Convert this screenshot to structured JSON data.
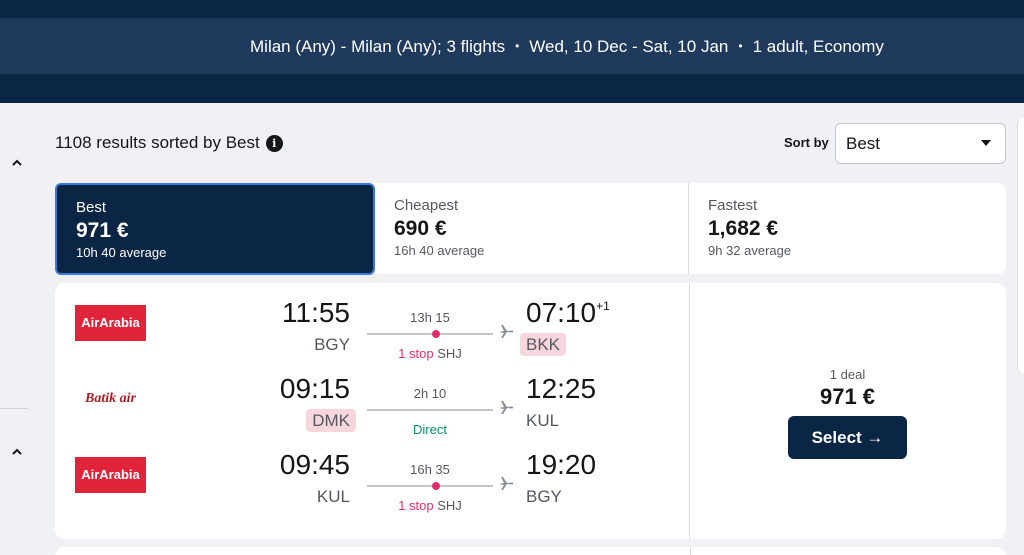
{
  "search": {
    "route": "Milan (Any) - Milan (Any); 3 flights",
    "dates": "Wed, 10 Dec - Sat, 10 Jan",
    "passengers": "1 adult, Economy",
    "separator": "•"
  },
  "results": {
    "count_text": "1108 results sorted by Best",
    "info_icon": "i",
    "sort_label": "Sort by",
    "sort_value": "Best"
  },
  "tabs": [
    {
      "label": "Best",
      "price": "971 €",
      "sub": "10h 40 average"
    },
    {
      "label": "Cheapest",
      "price": "690 €",
      "sub": "16h 40 average"
    },
    {
      "label": "Fastest",
      "price": "1,682 €",
      "sub": "9h 32 average"
    }
  ],
  "itinerary": {
    "legs": [
      {
        "airline_logo": "AirArabia",
        "dep_time": "11:55",
        "dep_code": "BGY",
        "duration": "13h 15",
        "stops": "1 stop",
        "via": "SHJ",
        "arr_time": "07:10",
        "arr_dayoffset": "+1",
        "arr_code": "BKK"
      },
      {
        "airline_logo": "Batik air",
        "dep_time": "09:15",
        "dep_code": "DMK",
        "duration": "2h 10",
        "stops": "Direct",
        "via": "",
        "arr_time": "12:25",
        "arr_dayoffset": "",
        "arr_code": "KUL"
      },
      {
        "airline_logo": "AirArabia",
        "dep_time": "09:45",
        "dep_code": "KUL",
        "duration": "16h 35",
        "stops": "1 stop",
        "via": "SHJ",
        "arr_time": "19:20",
        "arr_dayoffset": "",
        "arr_code": "BGY"
      }
    ],
    "deal_count": "1 deal",
    "price": "971 €",
    "select_label": "Select →"
  },
  "colors": {
    "header_navy": "#0b2545",
    "search_bar": "#1f3a5c",
    "stop_pink": "#e02c6b",
    "direct_green": "#0a8f70",
    "code_highlight": "#f7d7dd",
    "airarabia_red": "#e0253a"
  }
}
